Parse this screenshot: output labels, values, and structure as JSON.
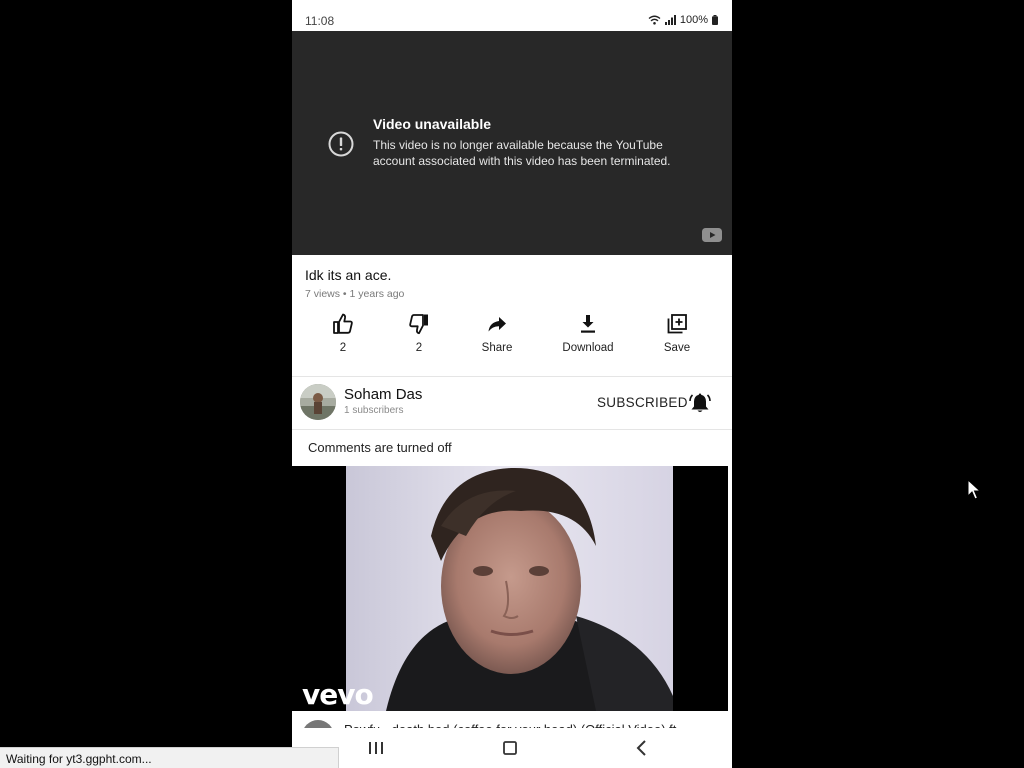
{
  "status_bar": {
    "time": "11:08",
    "battery": "100%"
  },
  "player": {
    "title": "Video unavailable",
    "message": "This video is no longer available because the YouTube account associated with this video has been terminated."
  },
  "video": {
    "title": "Idk its an ace.",
    "meta": "7 views • 1 years ago"
  },
  "actions": [
    {
      "icon": "thumbs-up-icon",
      "label": "2"
    },
    {
      "icon": "thumbs-down-icon",
      "label": "2"
    },
    {
      "icon": "share-icon",
      "label": "Share"
    },
    {
      "icon": "download-icon",
      "label": "Download"
    },
    {
      "icon": "save-to-playlist-icon",
      "label": "Save"
    }
  ],
  "channel": {
    "name": "Soham Das",
    "subscribers": "1 subscribers",
    "subscribe_label": "SUBSCRIBED"
  },
  "comments": {
    "label": "Comments are turned off"
  },
  "next_video": {
    "logo": "vevo",
    "title": "Powfu - death bed (coffee for your head) (Official Video) ft."
  },
  "browser": {
    "status": "Waiting for yt3.ggpht.com..."
  },
  "colors": {
    "player_bg": "#282828",
    "page_bg": "#000000",
    "panel_bg": "#ffffff"
  }
}
